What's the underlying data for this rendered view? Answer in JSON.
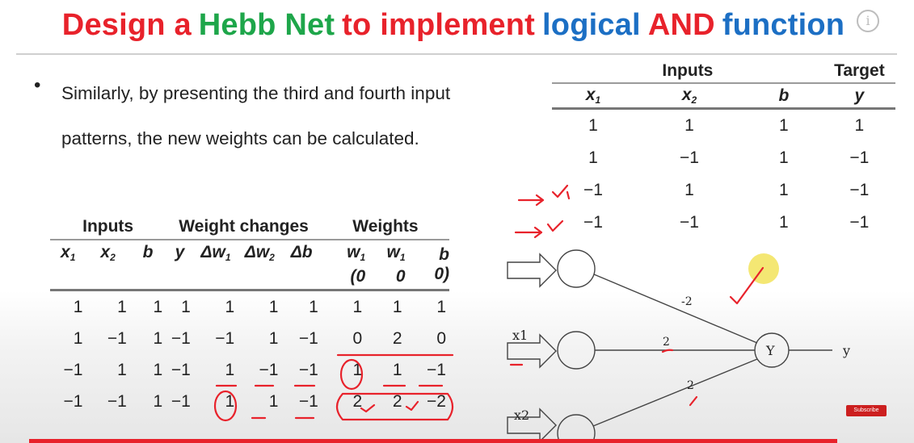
{
  "title": {
    "words": [
      {
        "text": "Design a",
        "color": "#e8222b"
      },
      {
        "text": "Hebb Net",
        "color": "#1ea64a"
      },
      {
        "text": "to implement",
        "color": "#e8222b"
      },
      {
        "text": "logical",
        "color": "#1c6fc4"
      },
      {
        "text": "AND",
        "color": "#e8222b"
      },
      {
        "text": "function",
        "color": "#1c6fc4"
      }
    ]
  },
  "info_icon": "info-icon",
  "bullet": {
    "line1": "Similarly, by presenting the third and fourth  input",
    "line2": "patterns, the new weights can be calculated."
  },
  "truth_table": {
    "group_inputs": "Inputs",
    "group_target": "Target",
    "headers": [
      "x",
      "x",
      "b",
      "y"
    ],
    "header_subs": [
      "1",
      "2",
      "",
      ""
    ],
    "rows": [
      [
        "1",
        "1",
        "1",
        "1"
      ],
      [
        "1",
        "−1",
        "1",
        "−1"
      ],
      [
        "−1",
        "1",
        "1",
        "−1"
      ],
      [
        "−1",
        "−1",
        "1",
        "−1"
      ]
    ]
  },
  "weights_table": {
    "group_inputs": "Inputs",
    "group_changes": "Weight changes",
    "group_weights": "Weights",
    "headers": [
      "x",
      "x",
      "b",
      "y",
      "Δw",
      "Δw",
      "Δb",
      "w",
      "w",
      "b"
    ],
    "header_subs": [
      "1",
      "2",
      "",
      "",
      "1",
      "2",
      "",
      "1",
      "1",
      ""
    ],
    "header_line2": [
      "",
      "",
      "",
      "",
      "",
      "",
      "",
      "(0",
      "0",
      "0)"
    ],
    "rows": [
      [
        "1",
        "1",
        "1",
        "1",
        "1",
        "1",
        "1",
        "1",
        "1",
        "1"
      ],
      [
        "1",
        "−1",
        "1",
        "−1",
        "−1",
        "1",
        "−1",
        "0",
        "2",
        "0"
      ],
      [
        "−1",
        "1",
        "1",
        "−1",
        "1",
        "−1",
        "−1",
        "1",
        "1",
        "−1"
      ],
      [
        "−1",
        "−1",
        "1",
        "−1",
        "1",
        "1",
        "−1",
        "2",
        "2",
        "−2"
      ]
    ]
  },
  "network": {
    "input_labels": [
      "x1",
      "x2"
    ],
    "output_node": "Y",
    "output_label": "y",
    "weights": [
      "-2",
      "2",
      "2"
    ],
    "ink_color": "#e8222b"
  },
  "subscribe": "Subscribe"
}
